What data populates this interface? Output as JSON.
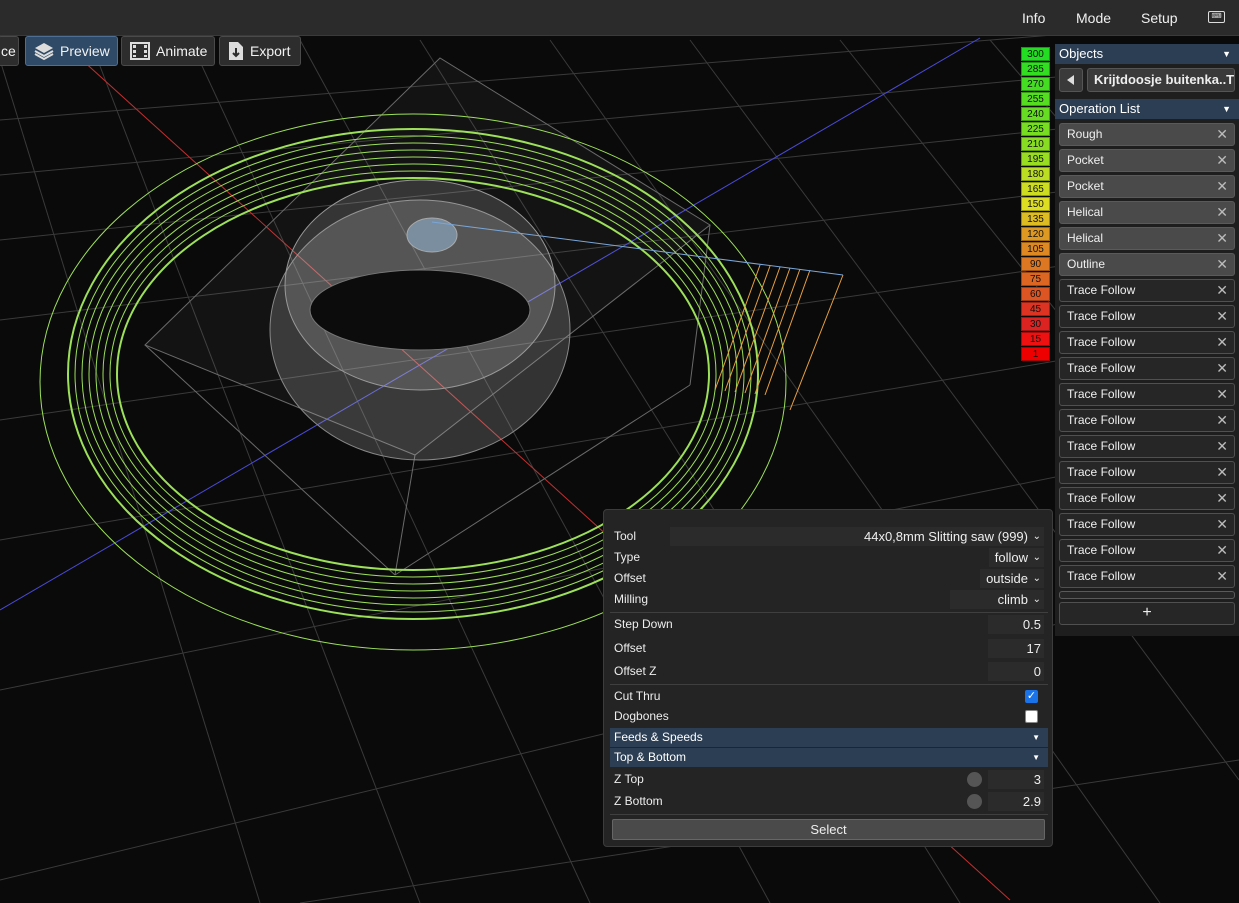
{
  "topbar": {
    "info": "Info",
    "mode": "Mode",
    "setup": "Setup",
    "keyboard_icon": "keyboard-icon"
  },
  "modes": {
    "partial_label": "ce",
    "preview": "Preview",
    "animate": "Animate",
    "export": "Export"
  },
  "legend": [
    {
      "value": "300",
      "color": "#22dd22"
    },
    {
      "value": "285",
      "color": "#33dd22"
    },
    {
      "value": "270",
      "color": "#44dd22"
    },
    {
      "value": "255",
      "color": "#55dd22"
    },
    {
      "value": "240",
      "color": "#66dd22"
    },
    {
      "value": "225",
      "color": "#77dd22"
    },
    {
      "value": "210",
      "color": "#88dd22"
    },
    {
      "value": "195",
      "color": "#99dd22"
    },
    {
      "value": "180",
      "color": "#bbdd22"
    },
    {
      "value": "165",
      "color": "#ccdd22"
    },
    {
      "value": "150",
      "color": "#dddd22"
    },
    {
      "value": "135",
      "color": "#ddbb22"
    },
    {
      "value": "120",
      "color": "#dd9922"
    },
    {
      "value": "105",
      "color": "#dd8822"
    },
    {
      "value": "90",
      "color": "#dd7722"
    },
    {
      "value": "75",
      "color": "#dd6622"
    },
    {
      "value": "60",
      "color": "#dd5522"
    },
    {
      "value": "45",
      "color": "#dd3322"
    },
    {
      "value": "30",
      "color": "#dd2222"
    },
    {
      "value": "15",
      "color": "#ee1111"
    },
    {
      "value": "1",
      "color": "#ee0000"
    }
  ],
  "objects": {
    "header": "Objects",
    "name": "Krijtdoosje buitenka..TL"
  },
  "operations": {
    "header": "Operation List",
    "items": [
      {
        "label": "Rough"
      },
      {
        "label": "Pocket"
      },
      {
        "label": "Pocket"
      },
      {
        "label": "Helical"
      },
      {
        "label": "Helical"
      },
      {
        "label": "Outline"
      },
      {
        "label": "Trace Follow"
      },
      {
        "label": "Trace Follow"
      },
      {
        "label": "Trace Follow"
      },
      {
        "label": "Trace Follow"
      },
      {
        "label": "Trace Follow"
      },
      {
        "label": "Trace Follow"
      },
      {
        "label": "Trace Follow"
      },
      {
        "label": "Trace Follow"
      },
      {
        "label": "Trace Follow"
      },
      {
        "label": "Trace Follow"
      },
      {
        "label": "Trace Follow"
      },
      {
        "label": "Trace Follow"
      }
    ],
    "close_glyph": "✕",
    "add_label": "+"
  },
  "editor": {
    "tool_label": "Tool",
    "tool_value": "44x0,8mm Slitting saw (999)",
    "type_label": "Type",
    "type_value": "follow",
    "offset_label": "Offset",
    "offset_value": "outside",
    "milling_label": "Milling",
    "milling_value": "climb",
    "stepdown_label": "Step Down",
    "stepdown_value": "0.5",
    "offset2_label": "Offset",
    "offset2_value": "17",
    "offsetz_label": "Offset Z",
    "offsetz_value": "0",
    "cutthru_label": "Cut Thru",
    "cutthru_checked": true,
    "dogbones_label": "Dogbones",
    "dogbones_checked": false,
    "feeds_label": "Feeds & Speeds",
    "topbottom_label": "Top & Bottom",
    "ztop_label": "Z Top",
    "ztop_value": "3",
    "zbottom_label": "Z Bottom",
    "zbottom_value": "2.9",
    "select_label": "Select"
  }
}
